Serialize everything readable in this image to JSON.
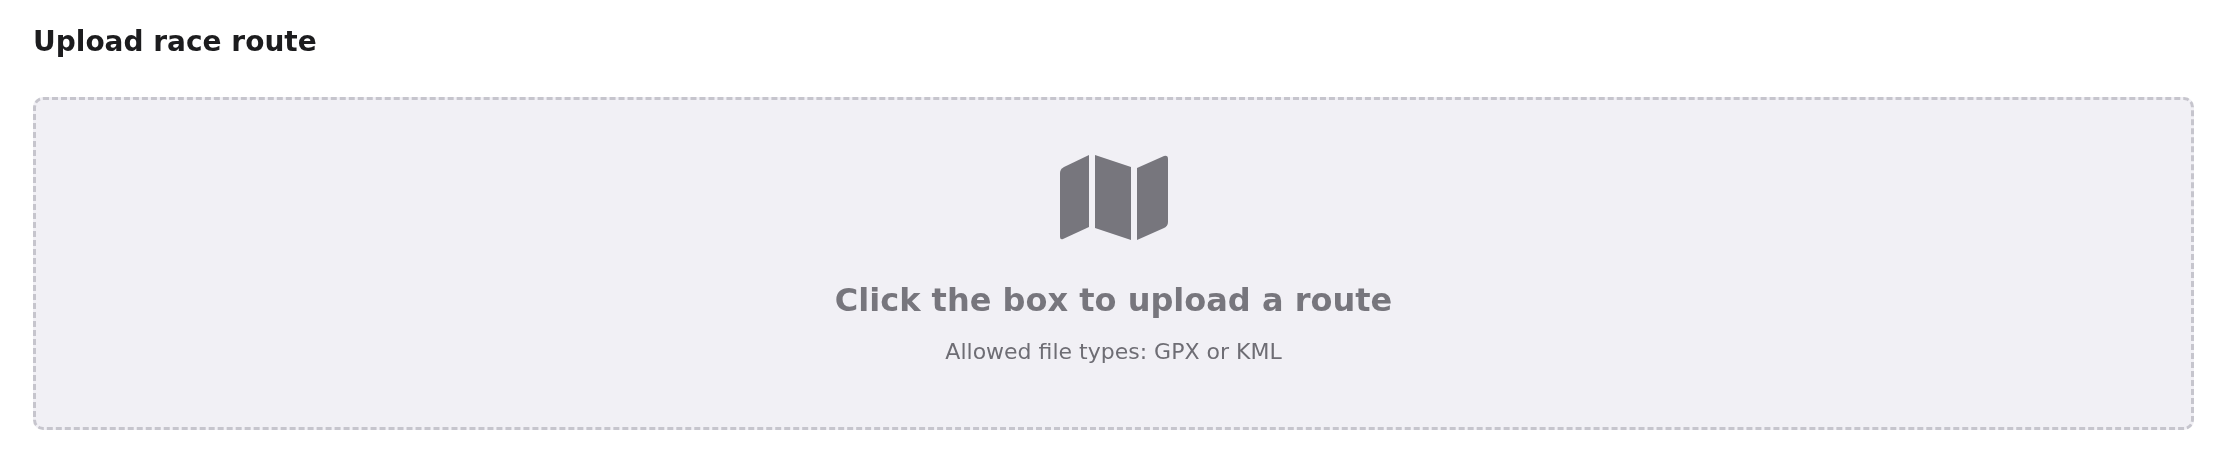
{
  "title": "Upload race route",
  "dropzone": {
    "heading": "Click the box to upload a route",
    "hint": "Allowed file types: GPX or KML"
  }
}
